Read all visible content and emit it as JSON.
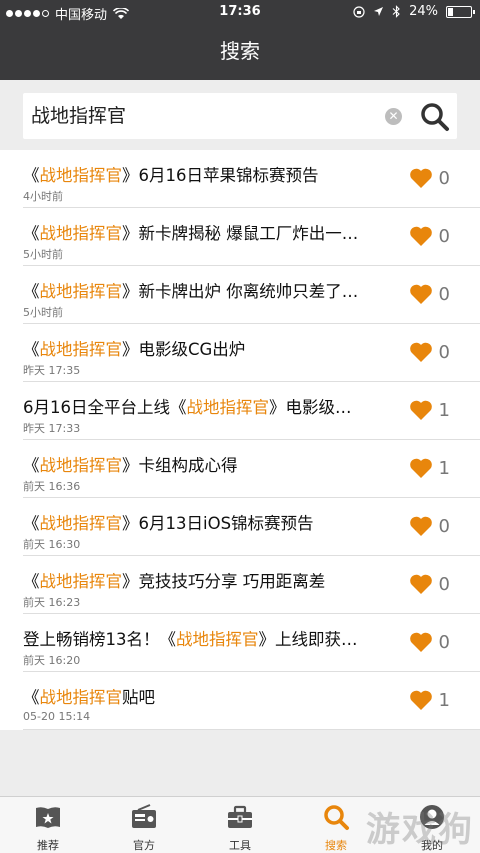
{
  "status": {
    "carrier": "中国移动",
    "time": "17:36",
    "battery": "24%",
    "battery_level": 0.24
  },
  "nav": {
    "title": "搜索"
  },
  "search": {
    "query": "战地指挥官"
  },
  "accent_color": "#e8860c",
  "results": [
    {
      "pre": "《",
      "highlight": "战地指挥官",
      "post": "》6月16日苹果锦标赛预告",
      "time": "4小时前",
      "likes": "0"
    },
    {
      "pre": "《",
      "highlight": "战地指挥官",
      "post": "》新卡牌揭秘 爆鼠工厂炸出一…",
      "time": "5小时前",
      "likes": "0"
    },
    {
      "pre": "《",
      "highlight": "战地指挥官",
      "post": "》新卡牌出炉 你离统帅只差了…",
      "time": "5小时前",
      "likes": "0"
    },
    {
      "pre": "《",
      "highlight": "战地指挥官",
      "post": "》电影级CG出炉",
      "time": "昨天 17:35",
      "likes": "0"
    },
    {
      "pre": "6月16日全平台上线《",
      "highlight": "战地指挥官",
      "post": "》电影级…",
      "time": "昨天 17:33",
      "likes": "1"
    },
    {
      "pre": "《",
      "highlight": "战地指挥官",
      "post": "》卡组构成心得",
      "time": "前天 16:36",
      "likes": "1"
    },
    {
      "pre": "《",
      "highlight": "战地指挥官",
      "post": "》6月13日iOS锦标赛预告",
      "time": "前天 16:30",
      "likes": "0"
    },
    {
      "pre": "《",
      "highlight": "战地指挥官",
      "post": "》竞技技巧分享 巧用距离差",
      "time": "前天 16:23",
      "likes": "0"
    },
    {
      "pre": "登上畅销榜13名！《",
      "highlight": "战地指挥官",
      "post": "》上线即获…",
      "time": "前天 16:20",
      "likes": "0"
    },
    {
      "pre": "《",
      "highlight": "战地指挥官",
      "post": "贴吧",
      "time": "05-20 15:14",
      "likes": "1"
    }
  ],
  "tabs": [
    {
      "label": "推荐",
      "icon": "book-star-icon"
    },
    {
      "label": "官方",
      "icon": "radio-icon"
    },
    {
      "label": "工具",
      "icon": "toolbox-icon"
    },
    {
      "label": "搜索",
      "icon": "search-icon"
    },
    {
      "label": "我的",
      "icon": "user-icon"
    }
  ],
  "active_tab": 3,
  "watermark": "游戏狗"
}
